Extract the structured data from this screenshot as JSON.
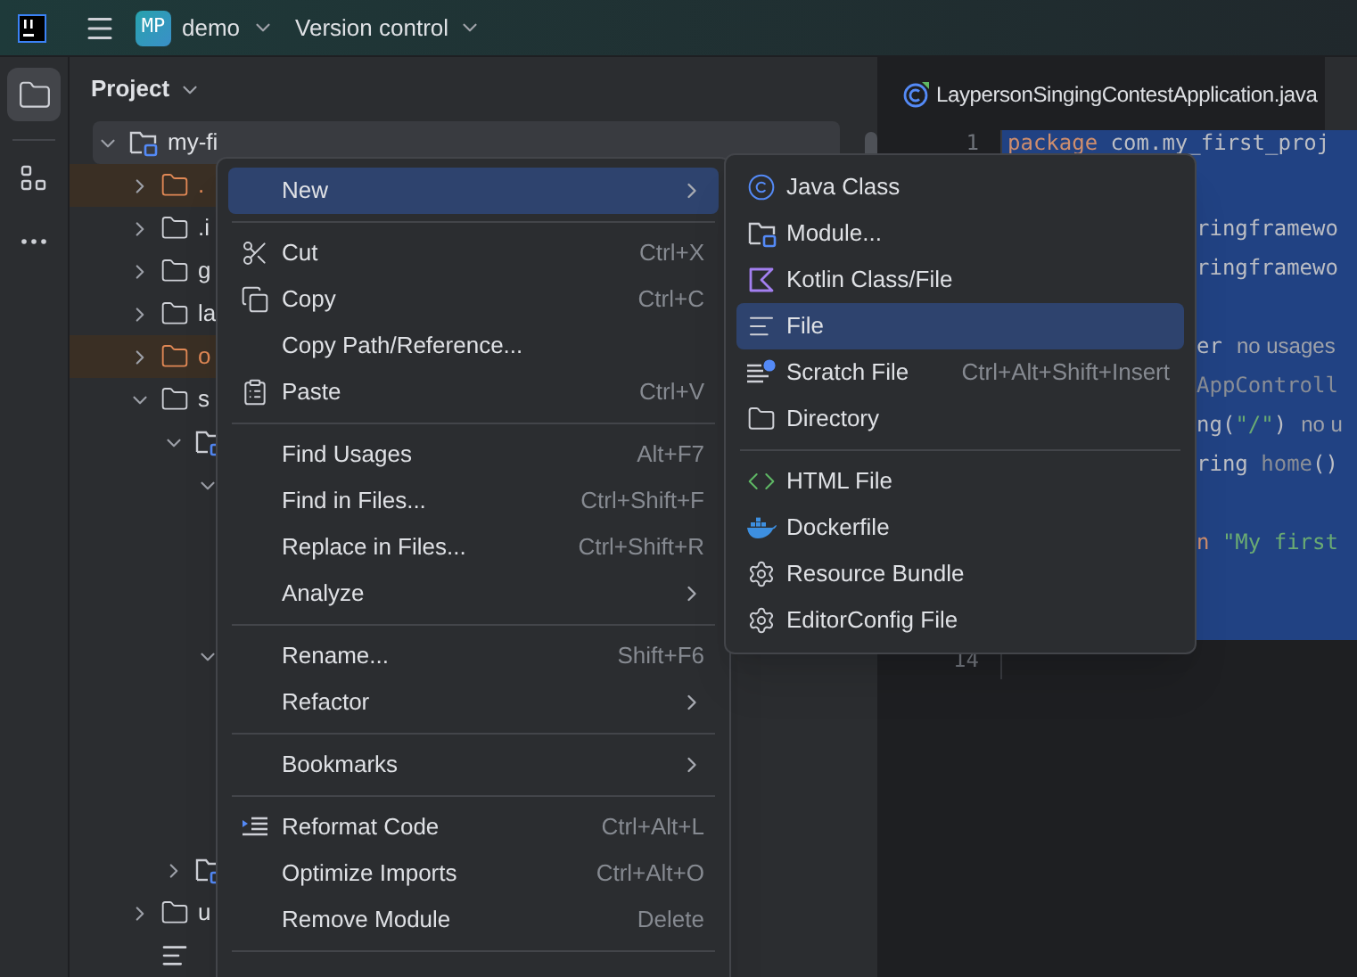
{
  "toolbar": {
    "project_badge": "MP",
    "project": "demo",
    "vcs": "Version control"
  },
  "sidebar": {
    "items": [
      {
        "kind": "folder",
        "selected": true
      },
      {
        "kind": "structure",
        "selected": false
      },
      {
        "kind": "more",
        "selected": false
      }
    ]
  },
  "project_panel": {
    "title": "Project",
    "tree": [
      {
        "label": "my-fi",
        "kind": "module",
        "expanded": true,
        "selected": true,
        "excluded": false,
        "children": [
          {
            "label": ".",
            "kind": "folder",
            "expanded": false,
            "selected": false,
            "excluded": true
          },
          {
            "label": ".i",
            "kind": "folder",
            "expanded": false,
            "selected": false,
            "excluded": false
          },
          {
            "label": "g",
            "kind": "folder",
            "expanded": false,
            "selected": false,
            "excluded": false
          },
          {
            "label": "la",
            "kind": "folder",
            "expanded": false,
            "selected": false,
            "excluded": false
          },
          {
            "label": "o",
            "kind": "folder",
            "expanded": false,
            "selected": false,
            "excluded": true
          },
          {
            "label": "s",
            "kind": "folder",
            "expanded": true,
            "selected": false,
            "excluded": false,
            "children": [
              {
                "kind": "module",
                "expanded": true,
                "children": [
                  {
                    "expanded": true,
                    "children": [
                      {
                        "kind": "hidden"
                      },
                      {
                        "kind": "hidden"
                      },
                      {
                        "kind": "hidden"
                      }
                    ]
                  },
                  {
                    "expanded": true,
                    "children": [
                      {
                        "kind": "hidden"
                      },
                      {
                        "kind": "hidden"
                      },
                      {
                        "kind": "hidden"
                      },
                      {
                        "kind": "hidden"
                      }
                    ]
                  }
                ]
              },
              {
                "kind": "module",
                "expanded": false
              }
            ]
          },
          {
            "label": "u",
            "kind": "folder",
            "expanded": false,
            "selected": false,
            "excluded": false
          },
          {
            "kind": "file"
          }
        ]
      }
    ]
  },
  "editor": {
    "tab": "LaypersonSingingContestApplication.java",
    "lines": [
      {
        "number": "1",
        "selected": true,
        "segments": [
          {
            "kind": "keyword",
            "text": "package "
          },
          {
            "kind": "plain",
            "text": "com.my_first_proj"
          }
        ]
      },
      {
        "selected": true
      },
      {
        "selected": true,
        "segments": [
          {
            "kind": "plain",
            "text": "ringframewo"
          }
        ]
      },
      {
        "selected": true,
        "segments": [
          {
            "kind": "plain",
            "text": "ringframewo"
          }
        ]
      },
      {
        "selected": true
      },
      {
        "selected": true,
        "segments": [
          {
            "kind": "annotation",
            "text": "er"
          },
          {
            "kind": "hint",
            "text": "no usages"
          }
        ]
      },
      {
        "selected": true,
        "segments": [
          {
            "kind": "dim",
            "text": "AppControll"
          }
        ]
      },
      {
        "selected": true,
        "segments": [
          {
            "kind": "annotation",
            "text": "ng("
          },
          {
            "kind": "string",
            "text": "\"/\""
          },
          {
            "kind": "annotation",
            "text": ")"
          },
          {
            "kind": "hint",
            "text": "no u"
          }
        ]
      },
      {
        "selected": true,
        "segments": [
          {
            "kind": "plain",
            "text": "ring "
          },
          {
            "kind": "dim",
            "text": "home"
          },
          {
            "kind": "plain",
            "text": "()"
          }
        ]
      },
      {
        "selected": true
      },
      {
        "selected": true,
        "segments": [
          {
            "kind": "keyword",
            "text": "n "
          },
          {
            "kind": "string",
            "text": "\"My first"
          }
        ]
      },
      {
        "selected": true
      },
      {
        "selected": true
      },
      {
        "number": "14",
        "selected": false
      }
    ]
  },
  "context_menu": {
    "items": [
      {
        "kind": "item",
        "label": "New",
        "submenu": true,
        "selected": true
      },
      {
        "kind": "separator"
      },
      {
        "kind": "cut",
        "label": "Cut",
        "shortcut": "Ctrl+X",
        "selected": false
      },
      {
        "kind": "copy",
        "label": "Copy",
        "shortcut": "Ctrl+C",
        "selected": false
      },
      {
        "kind": "item",
        "label": "Copy Path/Reference...",
        "selected": false
      },
      {
        "kind": "paste",
        "label": "Paste",
        "shortcut": "Ctrl+V",
        "selected": false
      },
      {
        "kind": "separator"
      },
      {
        "kind": "item",
        "label": "Find Usages",
        "shortcut": "Alt+F7",
        "selected": false
      },
      {
        "kind": "item",
        "label": "Find in Files...",
        "shortcut": "Ctrl+Shift+F",
        "selected": false
      },
      {
        "kind": "item",
        "label": "Replace in Files...",
        "shortcut": "Ctrl+Shift+R",
        "selected": false
      },
      {
        "kind": "item",
        "label": "Analyze",
        "submenu": true,
        "selected": false
      },
      {
        "kind": "separator"
      },
      {
        "kind": "item",
        "label": "Rename...",
        "shortcut": "Shift+F6",
        "selected": false
      },
      {
        "kind": "item",
        "label": "Refactor",
        "submenu": true,
        "selected": false
      },
      {
        "kind": "separator"
      },
      {
        "kind": "item",
        "label": "Bookmarks",
        "submenu": true,
        "selected": false
      },
      {
        "kind": "separator"
      },
      {
        "kind": "reformat",
        "label": "Reformat Code",
        "shortcut": "Ctrl+Alt+L",
        "selected": false
      },
      {
        "kind": "item",
        "label": "Optimize Imports",
        "shortcut": "Ctrl+Alt+O",
        "selected": false
      },
      {
        "kind": "item",
        "label": "Remove Module",
        "shortcut": "Delete",
        "selected": false
      },
      {
        "kind": "separator"
      }
    ]
  },
  "submenu": {
    "items": [
      {
        "kind": "java",
        "label": "Java Class",
        "selected": false
      },
      {
        "kind": "module",
        "label": "Module...",
        "selected": false
      },
      {
        "kind": "kotlin",
        "label": "Kotlin Class/File",
        "selected": false
      },
      {
        "kind": "file",
        "label": "File",
        "selected": true
      },
      {
        "kind": "scratch",
        "label": "Scratch File",
        "shortcut": "Ctrl+Alt+Shift+Insert",
        "selected": false
      },
      {
        "kind": "folder",
        "label": "Directory",
        "selected": false
      },
      {
        "kind": "separator"
      },
      {
        "kind": "html",
        "label": "HTML File",
        "selected": false
      },
      {
        "kind": "docker",
        "label": "Dockerfile",
        "selected": false
      },
      {
        "kind": "gear",
        "label": "Resource Bundle",
        "selected": false
      },
      {
        "kind": "gear",
        "label": "EditorConfig File",
        "selected": false
      }
    ]
  }
}
